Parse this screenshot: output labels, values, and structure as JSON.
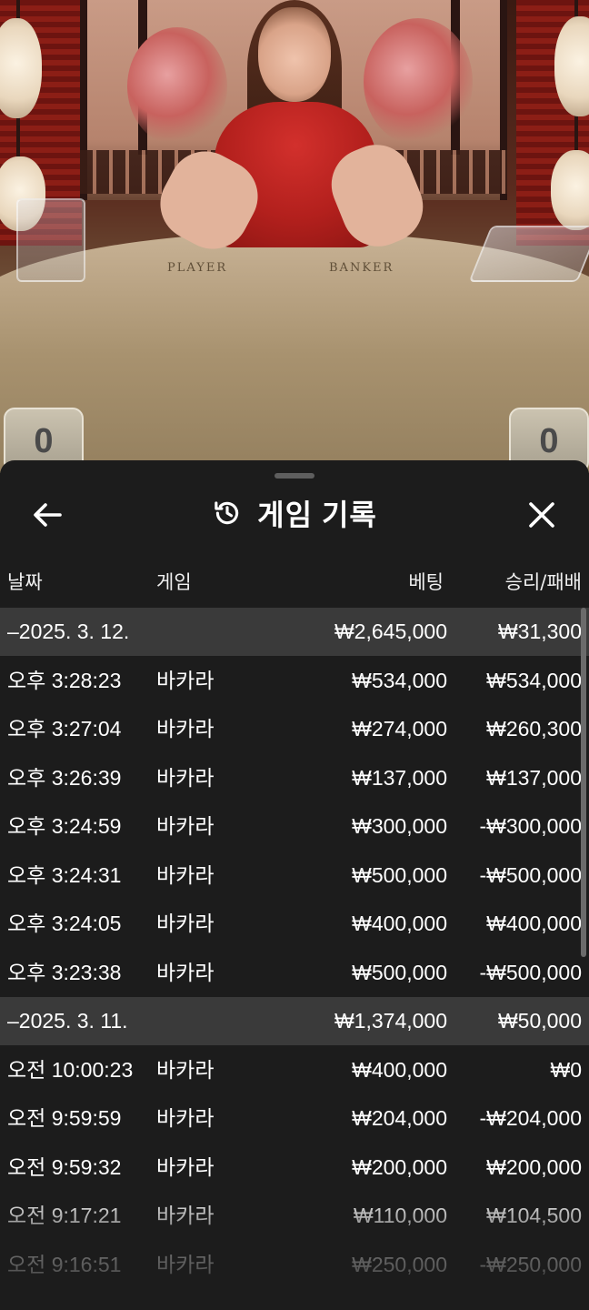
{
  "video": {
    "player_label": "PLAYER",
    "banker_label": "BANKER",
    "player_score": "0",
    "banker_score": "0"
  },
  "header": {
    "title": "게임 기록",
    "back_icon": "arrow-left-icon",
    "history_icon": "history-clock-icon",
    "close_icon": "close-icon"
  },
  "columns": {
    "date": "날짜",
    "game": "게임",
    "bet": "베팅",
    "win_loss": "승리/패배"
  },
  "groups": [
    {
      "date": "–2025. 3. 12.",
      "bet": "₩2,645,000",
      "win_loss": "₩31,300",
      "rows": [
        {
          "time": "오후 3:28:23",
          "game": "바카라",
          "bet": "₩534,000",
          "win_loss": "₩534,000"
        },
        {
          "time": "오후 3:27:04",
          "game": "바카라",
          "bet": "₩274,000",
          "win_loss": "₩260,300"
        },
        {
          "time": "오후 3:26:39",
          "game": "바카라",
          "bet": "₩137,000",
          "win_loss": "₩137,000"
        },
        {
          "time": "오후 3:24:59",
          "game": "바카라",
          "bet": "₩300,000",
          "win_loss": "-₩300,000"
        },
        {
          "time": "오후 3:24:31",
          "game": "바카라",
          "bet": "₩500,000",
          "win_loss": "-₩500,000"
        },
        {
          "time": "오후 3:24:05",
          "game": "바카라",
          "bet": "₩400,000",
          "win_loss": "₩400,000"
        },
        {
          "time": "오후 3:23:38",
          "game": "바카라",
          "bet": "₩500,000",
          "win_loss": "-₩500,000"
        }
      ]
    },
    {
      "date": "–2025. 3. 11.",
      "bet": "₩1,374,000",
      "win_loss": "₩50,000",
      "rows": [
        {
          "time": "오전 10:00:23",
          "game": "바카라",
          "bet": "₩400,000",
          "win_loss": "₩0"
        },
        {
          "time": "오전 9:59:59",
          "game": "바카라",
          "bet": "₩204,000",
          "win_loss": "-₩204,000"
        },
        {
          "time": "오전 9:59:32",
          "game": "바카라",
          "bet": "₩200,000",
          "win_loss": "₩200,000"
        },
        {
          "time": "오전 9:17:21",
          "game": "바카라",
          "bet": "₩110,000",
          "win_loss": "₩104,500"
        },
        {
          "time": "오전 9:16:51",
          "game": "바카라",
          "bet": "₩250,000",
          "win_loss": "-₩250,000"
        }
      ]
    }
  ],
  "colors": {
    "sheet_bg": "#1c1c1c",
    "group_row_bg": "#3a3a3a",
    "text": "#ffffff"
  }
}
